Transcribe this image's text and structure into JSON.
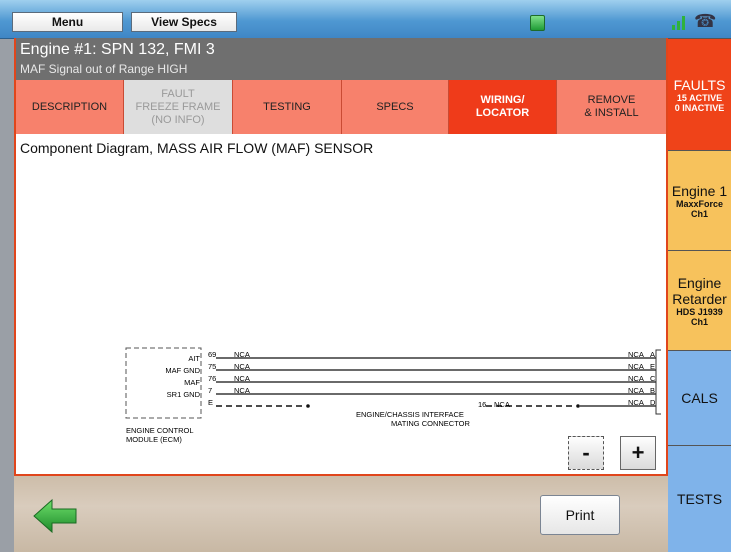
{
  "topbar": {
    "menu": "Menu",
    "view_specs": "View Specs"
  },
  "header": {
    "title": "Engine #1: SPN 132, FMI 3",
    "subtitle": "MAF Signal out of Range HIGH"
  },
  "tabs": [
    {
      "label": "DESCRIPTION",
      "state": "normal"
    },
    {
      "label": "FAULT\nFREEZE FRAME\n(NO INFO)",
      "state": "disabled"
    },
    {
      "label": "TESTING",
      "state": "normal"
    },
    {
      "label": "SPECS",
      "state": "normal"
    },
    {
      "label": "WIRING/\nLOCATOR",
      "state": "active"
    },
    {
      "label": "REMOVE\n& INSTALL",
      "state": "normal"
    }
  ],
  "content_title": "Component Diagram, MASS AIR FLOW (MAF) SENSOR",
  "diagram": {
    "rows": [
      {
        "pin_label": "AIT",
        "ecm_pin": "69",
        "left_nca": "NCA",
        "right_nca": "NCA",
        "sensor_pin": "A",
        "style": "solid"
      },
      {
        "pin_label": "MAF GND",
        "ecm_pin": "75",
        "left_nca": "NCA",
        "right_nca": "NCA",
        "sensor_pin": "E",
        "style": "solid"
      },
      {
        "pin_label": "MAF",
        "ecm_pin": "76",
        "left_nca": "NCA",
        "right_nca": "NCA",
        "sensor_pin": "C",
        "style": "solid"
      },
      {
        "pin_label": "SR1 GND",
        "ecm_pin": "7",
        "left_nca": "NCA",
        "right_nca": "NCA",
        "sensor_pin": "B",
        "style": "solid"
      },
      {
        "pin_label": "",
        "ecm_pin": "E",
        "left_nca": "",
        "right_nca": "NCA",
        "sensor_pin": "D",
        "style": "dashed"
      }
    ],
    "ecm_label_1": "ENGINE CONTROL",
    "ecm_label_2": "MODULE (ECM)",
    "interface_label_1": "ENGINE/CHASSIS INTERFACE",
    "interface_label_2": "MATING CONNECTOR",
    "interface_pin": "16",
    "interface_nca": "NCA"
  },
  "zoom": {
    "minus": "-",
    "plus": "+"
  },
  "bottom": {
    "print": "Print"
  },
  "right_tabs": {
    "faults": {
      "title": "FAULTS",
      "active": "15 ACTIVE",
      "inactive": "0 INACTIVE"
    },
    "engine1": {
      "title": "Engine 1",
      "sub1": "MaxxForce",
      "sub2": "Ch1"
    },
    "retarder": {
      "title1": "Engine",
      "title2": "Retarder",
      "sub1": "HDS J1939",
      "sub2": "Ch1"
    },
    "cals": {
      "title": "CALS"
    },
    "tests": {
      "title": "TESTS"
    }
  },
  "colors": {
    "accent": "#ef3b1a",
    "tab": "#f7816c",
    "yellow_tab": "#f7c25c",
    "blue_tab": "#7fb3ea"
  }
}
